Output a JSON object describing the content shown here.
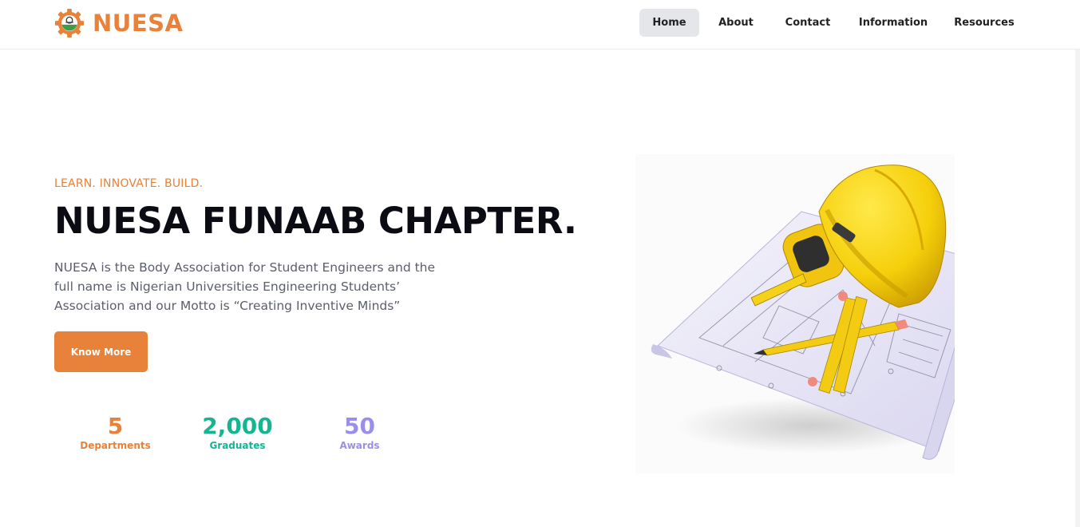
{
  "header": {
    "brand_name": "NUESA",
    "nav": [
      {
        "label": "Home",
        "active": true
      },
      {
        "label": "About",
        "active": false
      },
      {
        "label": "Contact",
        "active": false
      },
      {
        "label": "Information",
        "active": false
      },
      {
        "label": "Resources",
        "active": false
      }
    ]
  },
  "hero": {
    "eyebrow": "LEARN. INNOVATE. BUILD.",
    "title": "NUESA FUNAAB CHAPTER.",
    "description": "NUESA is the Body Association for Student Engineers and the full name is Nigerian Universities Engineering Students’ Association and our Motto is “Creating Inventive Minds”",
    "cta_label": "Know More",
    "image_icon": "engineering-helmet-blueprint-image"
  },
  "stats": [
    {
      "value": "5",
      "label": "Departments",
      "color": "#e8823a"
    },
    {
      "value": "2,000",
      "label": "Graduates",
      "color": "#14b591"
    },
    {
      "value": "50",
      "label": "Awards",
      "color": "#9a8df0"
    }
  ],
  "colors": {
    "brand": "#e8823a",
    "title": "#0b0b14",
    "body_text": "#5b5f6b",
    "nav_active_bg": "#e4e6ea"
  }
}
